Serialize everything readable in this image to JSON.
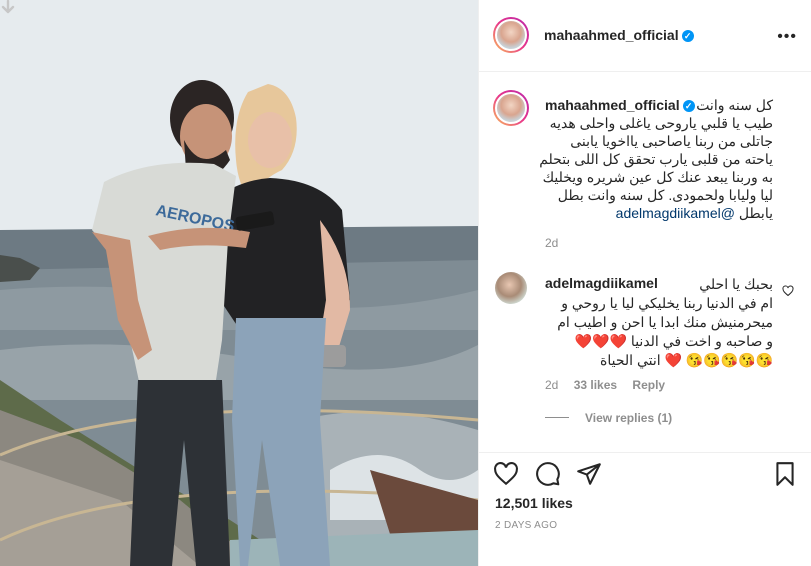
{
  "post": {
    "author": "mahaahmed_official",
    "more_icon": "more-horizontal-icon",
    "caption": {
      "line1": "كل سنه وانت",
      "body": "طيب يا قلبي ياروحى ياغلى واحلى هديه جاتلى من ربنا ياصاحبى يااخويا يابنى ياحته من قلبى يارب تحقق كل اللى بتحلم به وربنا يبعد عنك كل عين شريره ويخليك ليا وليابا ولحمودى. كل سنه وانت بطل يابطل",
      "mention": "@adelmagdiikamel",
      "time": "2d"
    },
    "comment": {
      "author": "adelmagdiikamel",
      "text_lines": [
        "بحبك يا احلي",
        "ام في الدنيا ربنا يخليكي ليا يا روحي و",
        "ميحرمنيش منك ابدا يا احن و اطيب ام",
        "و صاحبه و اخت في الدنيا ❤️❤️❤️",
        "😘😘😘😘😘 ❤️ انتي الحياة"
      ],
      "time": "2d",
      "likes": "33 likes",
      "reply": "Reply",
      "view_replies": "View replies (1)"
    },
    "likes_count": "12,501 likes",
    "date": "2 DAYS AGO"
  },
  "colors": {
    "verified": "#0095f6",
    "heart": "#ed4956",
    "muted": "#8e8e8e",
    "mention": "#00376b"
  }
}
